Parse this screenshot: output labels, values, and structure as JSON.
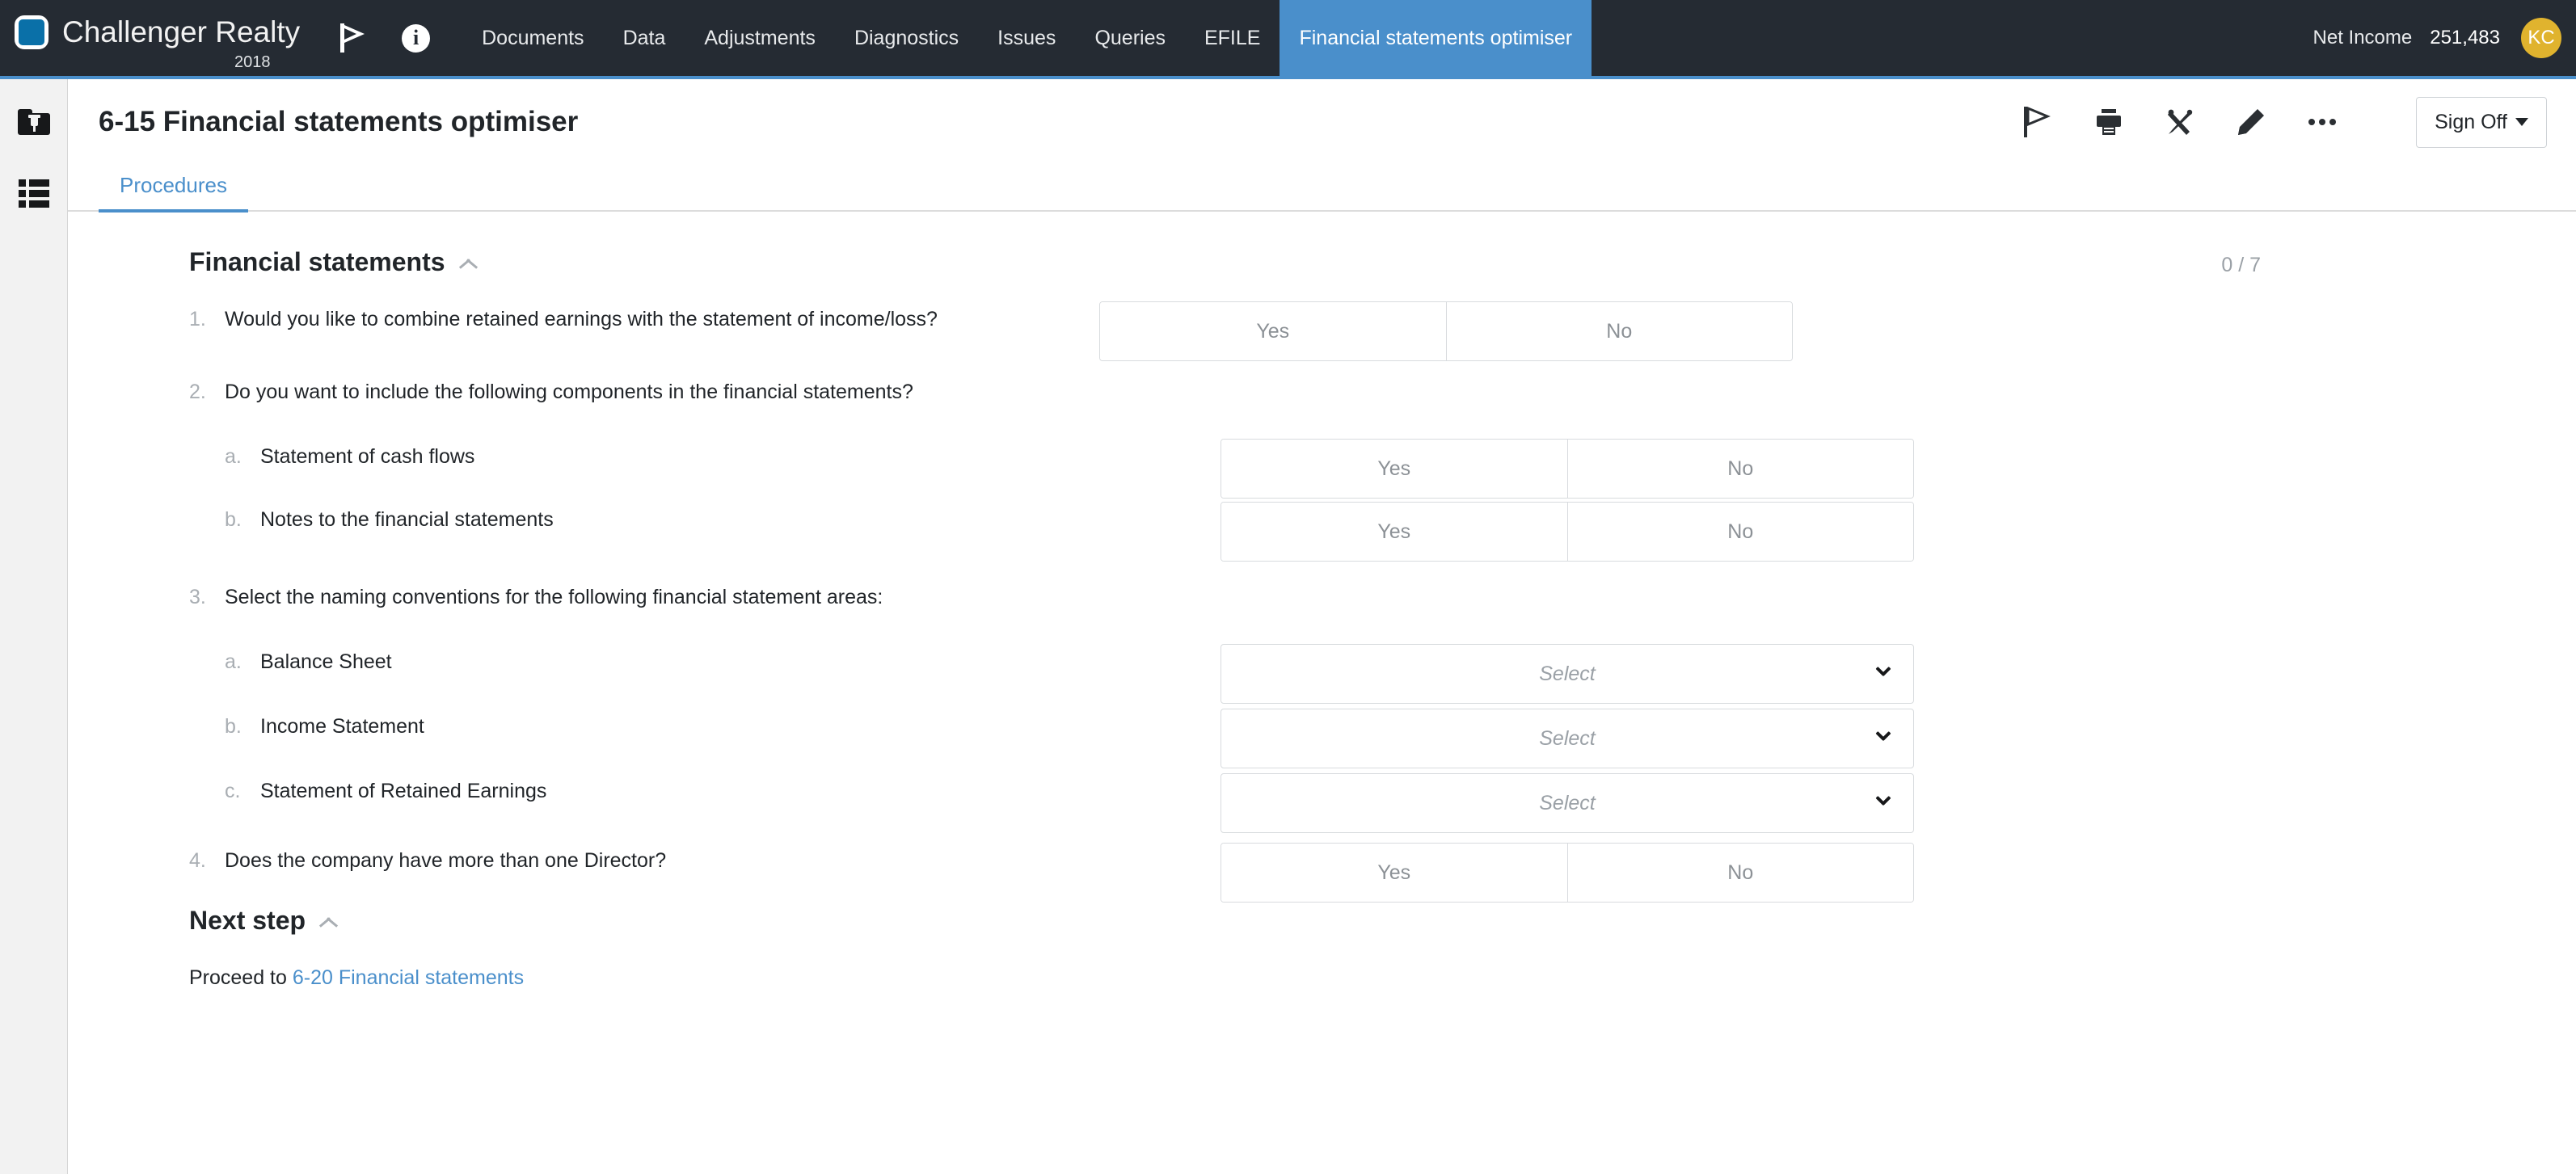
{
  "header": {
    "brand": "Challenger Realty",
    "year": "2018",
    "flag_icon": "flag-icon",
    "info_icon": "info-icon",
    "nav_tabs": [
      {
        "label": "Documents",
        "active": false
      },
      {
        "label": "Data",
        "active": false
      },
      {
        "label": "Adjustments",
        "active": false
      },
      {
        "label": "Diagnostics",
        "active": false
      },
      {
        "label": "Issues",
        "active": false
      },
      {
        "label": "Queries",
        "active": false
      },
      {
        "label": "EFILE",
        "active": false
      },
      {
        "label": "Financial statements optimiser",
        "active": true
      }
    ],
    "net_income_label": "Net Income",
    "net_income_value": "251,483",
    "avatar_initials": "KC",
    "accent_blue": "#4a8fcb",
    "bar_background": "#252b33",
    "avatar_color": "#e0b32e"
  },
  "left_rail": {
    "items": [
      {
        "icon": "pinned-folder-icon"
      },
      {
        "icon": "list-icon"
      }
    ]
  },
  "page": {
    "title": "6-15 Financial statements optimiser",
    "toolbar": [
      {
        "icon": "flag-icon"
      },
      {
        "icon": "print-icon"
      },
      {
        "icon": "tools-icon"
      },
      {
        "icon": "pencil-icon"
      },
      {
        "icon": "ellipsis-icon"
      }
    ],
    "sign_off_label": "Sign Off",
    "tabs": [
      {
        "label": "Procedures",
        "active": true
      }
    ]
  },
  "section": {
    "title": "Financial statements",
    "collapse_icon": "chevron-up-icon",
    "progress": "0 / 7",
    "questions": [
      {
        "number": "1.",
        "text": "Would you like to combine retained earnings with the statement of income/loss?",
        "control": "yesno",
        "yes": "Yes",
        "no": "No"
      },
      {
        "number": "2.",
        "text": "Do you want to include the following  components in the financial statements?",
        "control": "none",
        "sub": [
          {
            "number": "a.",
            "text": "Statement of cash flows",
            "control": "yesno",
            "yes": "Yes",
            "no": "No"
          },
          {
            "number": "b.",
            "text": "Notes to the financial statements",
            "control": "yesno",
            "yes": "Yes",
            "no": "No"
          }
        ]
      },
      {
        "number": "3.",
        "text": "Select the naming conventions for the following financial statement areas:",
        "control": "none",
        "sub": [
          {
            "number": "a.",
            "text": "Balance Sheet",
            "control": "select",
            "placeholder": "Select"
          },
          {
            "number": "b.",
            "text": "Income Statement",
            "control": "select",
            "placeholder": "Select"
          },
          {
            "number": "c.",
            "text": "Statement of Retained Earnings",
            "control": "select",
            "placeholder": "Select"
          }
        ]
      },
      {
        "number": "4.",
        "text": "Does the company have more than one Director?",
        "control": "yesno",
        "yes": "Yes",
        "no": "No"
      }
    ]
  },
  "next_step": {
    "title": "Next step",
    "collapse_icon": "chevron-up-icon",
    "prefix": "Proceed to ",
    "link": "6-20 Financial statements"
  }
}
